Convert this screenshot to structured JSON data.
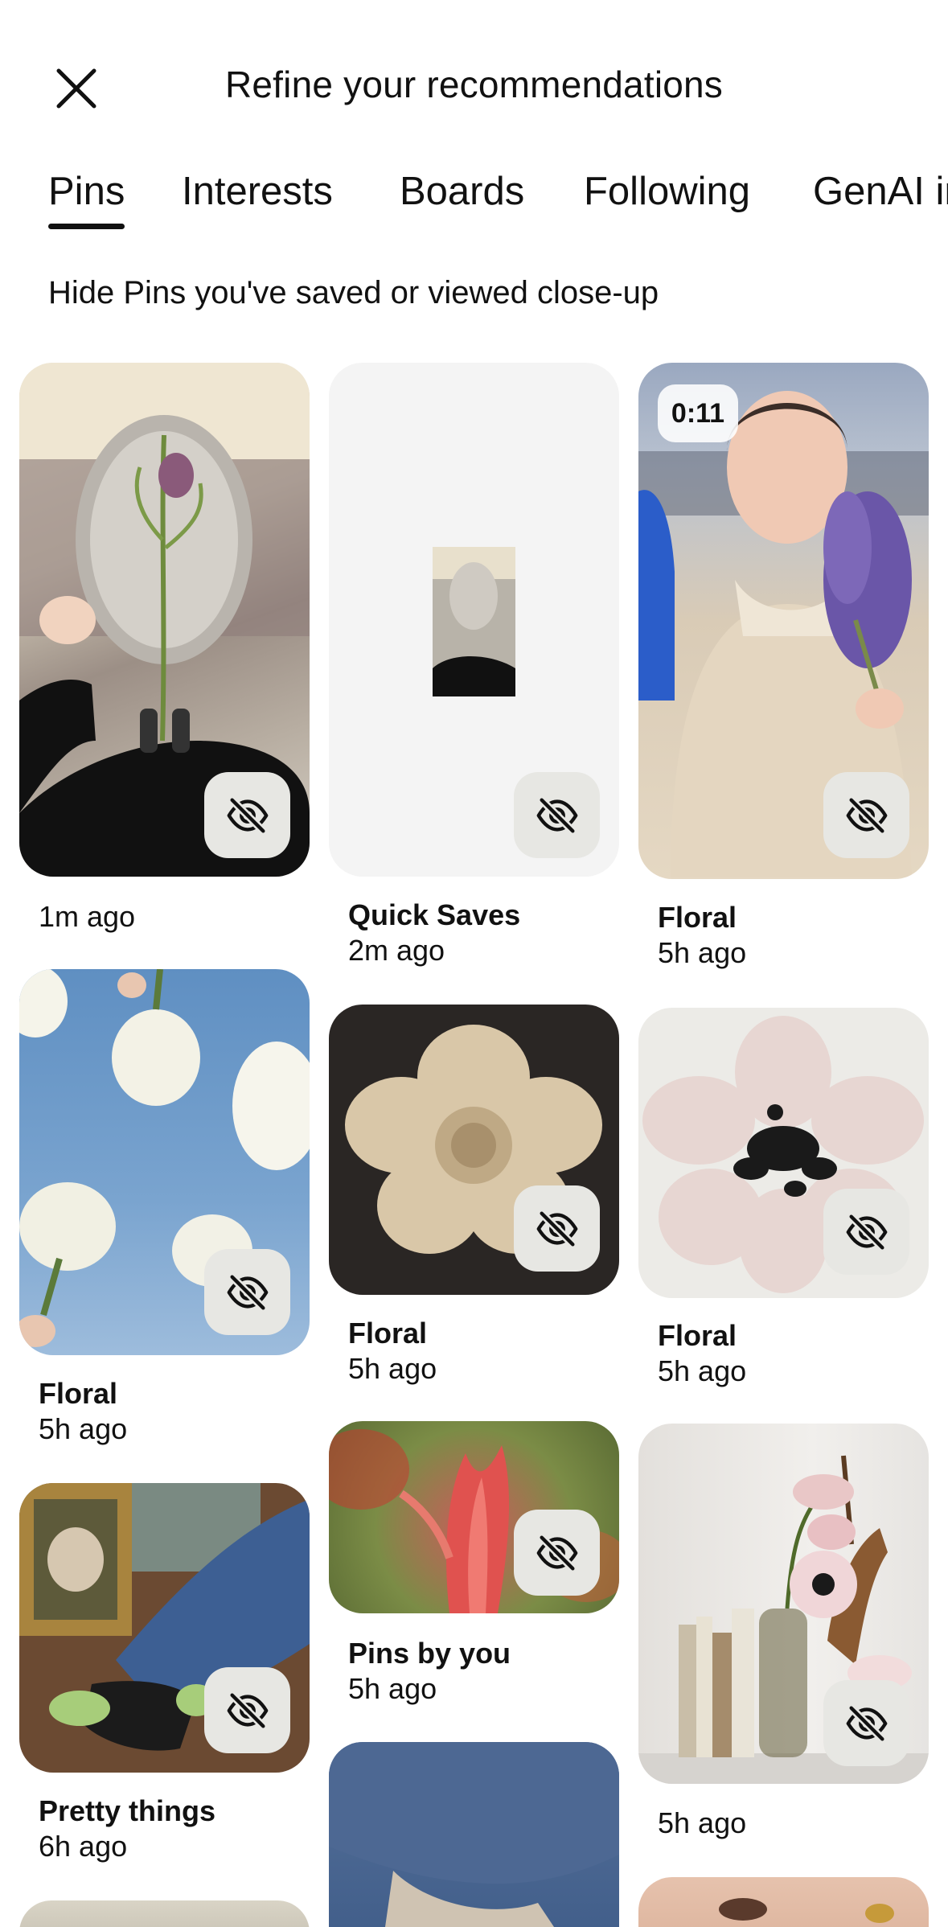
{
  "header": {
    "title": "Refine your recommendations",
    "close_icon": "close-icon"
  },
  "tabs": [
    {
      "label": "Pins",
      "active": true
    },
    {
      "label": "Interests"
    },
    {
      "label": "Boards"
    },
    {
      "label": "Following"
    },
    {
      "label": "GenAI interests"
    }
  ],
  "subtitle": "Hide Pins you've saved or viewed close-up",
  "pins": [
    {
      "board": "",
      "time": "1m ago"
    },
    {
      "board": "Quick Saves",
      "time": "2m ago"
    },
    {
      "board": "Floral",
      "time": "5h ago",
      "duration": "0:11"
    },
    {
      "board": "Floral",
      "time": "5h ago"
    },
    {
      "board": "Floral",
      "time": "5h ago"
    },
    {
      "board": "Floral",
      "time": "5h ago"
    },
    {
      "board": "Pretty things",
      "time": "6h ago"
    },
    {
      "board": "Pins by you",
      "time": "5h ago"
    },
    {
      "board": "",
      "time": "5h ago"
    }
  ],
  "icons": {
    "hide": "eye-off-icon"
  },
  "colors": {
    "hide_button_bg": "#e7e7e3",
    "text": "#111111"
  }
}
